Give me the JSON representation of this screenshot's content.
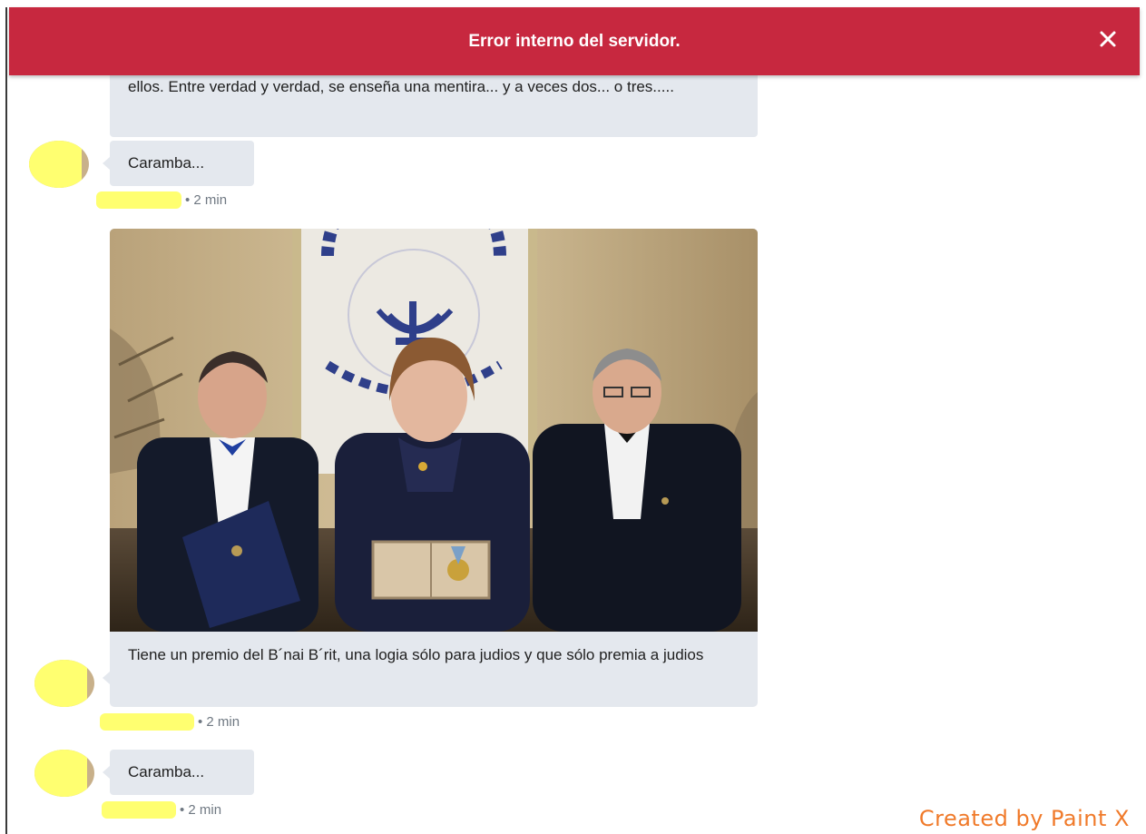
{
  "error_banner": {
    "message": "Error interno del servidor.",
    "close_icon": "close-icon",
    "background_color": "#c7283f"
  },
  "messages": [
    {
      "text": "ellos. Entre verdad y verdad, se enseña una mentira... y a veces dos... o tres....."
    },
    {
      "text": "Caramba...",
      "time": "• 2 min"
    },
    {
      "caption": "Tiene un premio del B´nai B´rit, una logia sólo para judios y que sólo premia a judios",
      "time": "• 2 min"
    },
    {
      "text": "Caramba...",
      "time": "• 2 min"
    }
  ],
  "watermark": "Created by Paint X",
  "colors": {
    "bubble": "#e4e8ee",
    "redaction": "#ffff70",
    "meta_text": "#6f7882",
    "watermark": "#f07a2a"
  }
}
